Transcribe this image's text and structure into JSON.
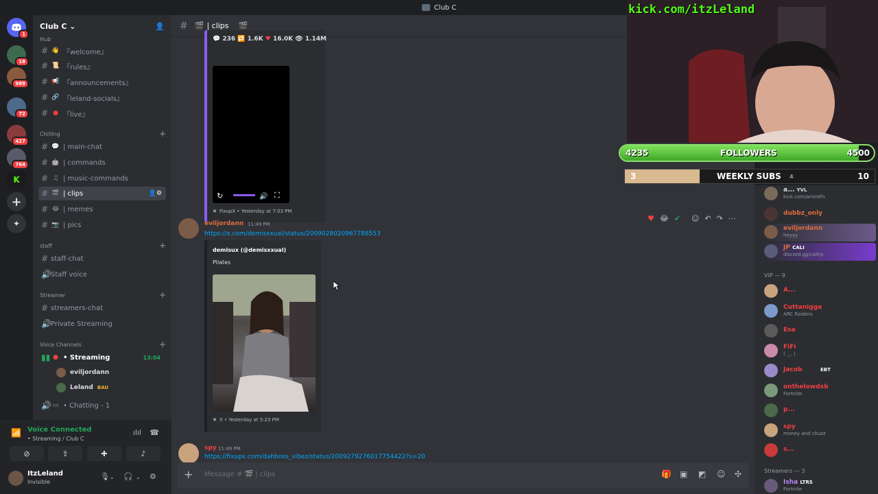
{
  "window": {
    "title": "Club C"
  },
  "rail": {
    "servers": [
      {
        "name": "discord-home",
        "badge": "1"
      },
      {
        "name": "server-2",
        "badge": "18"
      },
      {
        "name": "server-3",
        "badge": "989"
      },
      {
        "name": "server-4",
        "badge": "72"
      },
      {
        "name": "server-5",
        "badge": "427"
      },
      {
        "name": "server-6",
        "badge": "764"
      }
    ]
  },
  "guild": {
    "name": "Club C"
  },
  "channels": {
    "cat_hub": "Hub",
    "welcome": "『welcome』",
    "rules": "『rules』",
    "announcements": "『announcements』",
    "leland_socials": "『leland-socials』",
    "live": "『live』",
    "cat_chilling": "Chilling",
    "main_chat": "| main-chat",
    "commands": "| commands",
    "music_commands": "| music-commands",
    "clips": "| clips",
    "memes": "| memes",
    "pics": "| pics",
    "cat_staff": "staff",
    "staff_chat": "staff-chat",
    "staff_voice": "Staff voice",
    "cat_streamer": "Streamer",
    "streamers_chat": "streamers-chat",
    "private_streaming": "Private Streaming",
    "cat_voice": "Voice Channels",
    "streaming": "• Streaming",
    "streaming_time": "13:04",
    "vc_user1": "eviljordann",
    "vc_user2": "Leland",
    "vc_user2_tag": "BAU",
    "chatting": "• Chatting - 1"
  },
  "panel": {
    "voice_connected": "Voice Connected",
    "voice_sub": "• Streaming / Club C",
    "username": "ItzLeland",
    "status": "Invisible"
  },
  "chat": {
    "channel": "| clips",
    "stats": {
      "comments": "236",
      "reposts": "1.6K",
      "likes": "16.0K",
      "views": "1.14M"
    },
    "embed1_footer": "FixupX • Yesterday at 7:03 PM",
    "msg1": {
      "author": "eviljordann",
      "time": "11:49 PM",
      "link": "https://x.com/demisxxual/status/2009028020967788553",
      "embed_author": "demisux (@demisxxual)",
      "embed_text": "Pilates",
      "footer": "X • Yesterday at 5:23 PM"
    },
    "msg2": {
      "author": "spy",
      "time": "11:49 PM",
      "link": "https://fixupx.com/dahboss_vibez/status/2009279276017754422?s=20"
    },
    "placeholder": "Message # 🎬 | clips"
  },
  "stream": {
    "kick_url": "kick.com/itzLeland",
    "followers_label": "FOLLOWERS",
    "followers_current": "4235",
    "followers_goal": "4500",
    "followers_fraction": 0.94,
    "subs_label": "WEEKLY SUBS",
    "subs_current": "3",
    "subs_goal": "10",
    "subs_mid": "4",
    "subs_fraction": 0.3
  },
  "members": {
    "top": [
      {
        "name": "a...",
        "sub": "kick.com/amirefn",
        "tag": "YVL",
        "color": "#dbdee1"
      },
      {
        "name": "dubbz_only",
        "sub": "",
        "color": "#e06c3c"
      },
      {
        "name": "eviljordann",
        "sub": "heyyy",
        "color": "#e06c3c"
      },
      {
        "name": "JP",
        "sub": "discord.gg/calirp",
        "tag": "CALI",
        "color": "#e06c3c"
      }
    ],
    "vip_header": "VIP — 9",
    "vip": [
      {
        "name": "A...",
        "sub": "",
        "color": "#f23f43"
      },
      {
        "name": "Cuttaniggа",
        "sub": "ARC Raiders",
        "color": "#f23f43"
      },
      {
        "name": "Esa",
        "sub": "",
        "color": "#f23f43"
      },
      {
        "name": "FiFi",
        "sub": "( ._. )",
        "color": "#f23f43"
      },
      {
        "name": "Jacob",
        "sub": "",
        "tag": "EBT",
        "color": "#f23f43"
      },
      {
        "name": "onthelowdxb",
        "sub": "Fortnite",
        "color": "#f23f43"
      },
      {
        "name": "p...",
        "sub": "",
        "color": "#f23f43"
      },
      {
        "name": "spy",
        "sub": "money and chuzz",
        "color": "#f23f43"
      },
      {
        "name": "s...",
        "sub": "",
        "color": "#f23f43"
      }
    ],
    "streamers_header": "Streamers — 3",
    "streamers": [
      {
        "name": "Isha",
        "sub": "Fortnite",
        "tag": "LTRS",
        "color": "#c084fc"
      }
    ]
  },
  "colors": {
    "accent": "#5865f2",
    "kick_green": "#53fc18",
    "link": "#00a8fc"
  }
}
